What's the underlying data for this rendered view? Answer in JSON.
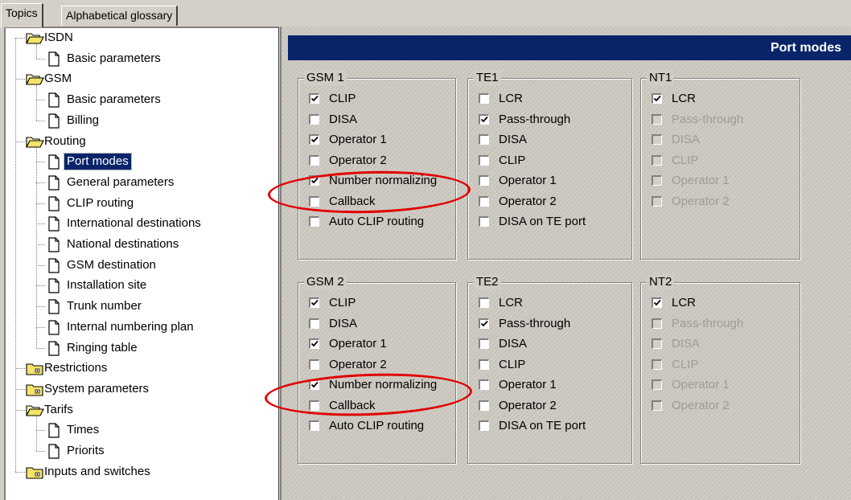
{
  "tabs": [
    {
      "label": "Topics",
      "active": true
    },
    {
      "label": "Alphabetical glossary",
      "active": false
    }
  ],
  "tree": {
    "nodes": [
      {
        "label": "ISDN",
        "icon": "open-folder-icon",
        "level": 0
      },
      {
        "label": "Basic parameters",
        "icon": "document-icon",
        "level": 1
      },
      {
        "label": "GSM",
        "icon": "open-folder-icon",
        "level": 0
      },
      {
        "label": "Basic parameters",
        "icon": "document-icon",
        "level": 1
      },
      {
        "label": "Billing",
        "icon": "document-icon",
        "level": 1
      },
      {
        "label": "Routing",
        "icon": "open-folder-icon",
        "level": 0
      },
      {
        "label": "Port modes",
        "icon": "document-icon",
        "level": 1,
        "selected": true
      },
      {
        "label": "General parameters",
        "icon": "document-icon",
        "level": 1
      },
      {
        "label": "CLIP routing",
        "icon": "document-icon",
        "level": 1
      },
      {
        "label": "International destinations",
        "icon": "document-icon",
        "level": 1
      },
      {
        "label": "National destinations",
        "icon": "document-icon",
        "level": 1
      },
      {
        "label": "GSM destination",
        "icon": "document-icon",
        "level": 1
      },
      {
        "label": "Installation site",
        "icon": "document-icon",
        "level": 1
      },
      {
        "label": "Trunk number",
        "icon": "document-icon",
        "level": 1
      },
      {
        "label": "Internal numbering plan",
        "icon": "document-icon",
        "level": 1
      },
      {
        "label": "Ringing table",
        "icon": "document-icon",
        "level": 1
      },
      {
        "label": "Restrictions",
        "icon": "closed-folder-icon",
        "level": 0
      },
      {
        "label": "System parameters",
        "icon": "closed-folder-icon",
        "level": 0
      },
      {
        "label": "Tarifs",
        "icon": "open-folder-icon",
        "level": 0
      },
      {
        "label": "Times",
        "icon": "document-icon",
        "level": 1
      },
      {
        "label": "Priorits",
        "icon": "document-icon",
        "level": 1
      },
      {
        "label": "Inputs and switches",
        "icon": "closed-folder-icon",
        "level": 0
      }
    ]
  },
  "pane": {
    "title": "Port modes",
    "groups": [
      {
        "title": "GSM 1",
        "options": [
          {
            "label": "CLIP",
            "checked": true,
            "enabled": true
          },
          {
            "label": "DISA",
            "checked": false,
            "enabled": true
          },
          {
            "label": "Operator 1",
            "checked": true,
            "enabled": true
          },
          {
            "label": "Operator 2",
            "checked": false,
            "enabled": true
          },
          {
            "label": "Number normalizing",
            "checked": true,
            "enabled": true
          },
          {
            "label": "Callback",
            "checked": false,
            "enabled": true
          },
          {
            "label": "Auto CLIP routing",
            "checked": false,
            "enabled": true
          }
        ]
      },
      {
        "title": "TE1",
        "options": [
          {
            "label": "LCR",
            "checked": false,
            "enabled": true
          },
          {
            "label": "Pass-through",
            "checked": true,
            "enabled": true
          },
          {
            "label": "DISA",
            "checked": false,
            "enabled": true
          },
          {
            "label": "CLIP",
            "checked": false,
            "enabled": true
          },
          {
            "label": "Operator 1",
            "checked": false,
            "enabled": true
          },
          {
            "label": "Operator 2",
            "checked": false,
            "enabled": true
          },
          {
            "label": "DISA on TE port",
            "checked": false,
            "enabled": true
          }
        ]
      },
      {
        "title": "NT1",
        "options": [
          {
            "label": "LCR",
            "checked": true,
            "enabled": true
          },
          {
            "label": "Pass-through",
            "checked": false,
            "enabled": false
          },
          {
            "label": "DISA",
            "checked": false,
            "enabled": false
          },
          {
            "label": "CLIP",
            "checked": false,
            "enabled": false
          },
          {
            "label": "Operator 1",
            "checked": false,
            "enabled": false
          },
          {
            "label": "Operator 2",
            "checked": false,
            "enabled": false
          }
        ]
      },
      {
        "title": "GSM 2",
        "options": [
          {
            "label": "CLIP",
            "checked": true,
            "enabled": true
          },
          {
            "label": "DISA",
            "checked": false,
            "enabled": true
          },
          {
            "label": "Operator 1",
            "checked": true,
            "enabled": true
          },
          {
            "label": "Operator 2",
            "checked": false,
            "enabled": true
          },
          {
            "label": "Number normalizing",
            "checked": true,
            "enabled": true
          },
          {
            "label": "Callback",
            "checked": false,
            "enabled": true
          },
          {
            "label": "Auto CLIP routing",
            "checked": false,
            "enabled": true
          }
        ]
      },
      {
        "title": "TE2",
        "options": [
          {
            "label": "LCR",
            "checked": false,
            "enabled": true
          },
          {
            "label": "Pass-through",
            "checked": true,
            "enabled": true
          },
          {
            "label": "DISA",
            "checked": false,
            "enabled": true
          },
          {
            "label": "CLIP",
            "checked": false,
            "enabled": true
          },
          {
            "label": "Operator 1",
            "checked": false,
            "enabled": true
          },
          {
            "label": "Operator 2",
            "checked": false,
            "enabled": true
          },
          {
            "label": "DISA on TE port",
            "checked": false,
            "enabled": true
          }
        ]
      },
      {
        "title": "NT2",
        "options": [
          {
            "label": "LCR",
            "checked": true,
            "enabled": true
          },
          {
            "label": "Pass-through",
            "checked": false,
            "enabled": false
          },
          {
            "label": "DISA",
            "checked": false,
            "enabled": false
          },
          {
            "label": "CLIP",
            "checked": false,
            "enabled": false
          },
          {
            "label": "Operator 1",
            "checked": false,
            "enabled": false
          },
          {
            "label": "Operator 2",
            "checked": false,
            "enabled": false
          }
        ]
      }
    ]
  },
  "colors": {
    "selection": "#0a246a",
    "header_bg": "#0a246a",
    "highlight_ellipse": "#e00000",
    "disabled_text": "#a09c94"
  }
}
